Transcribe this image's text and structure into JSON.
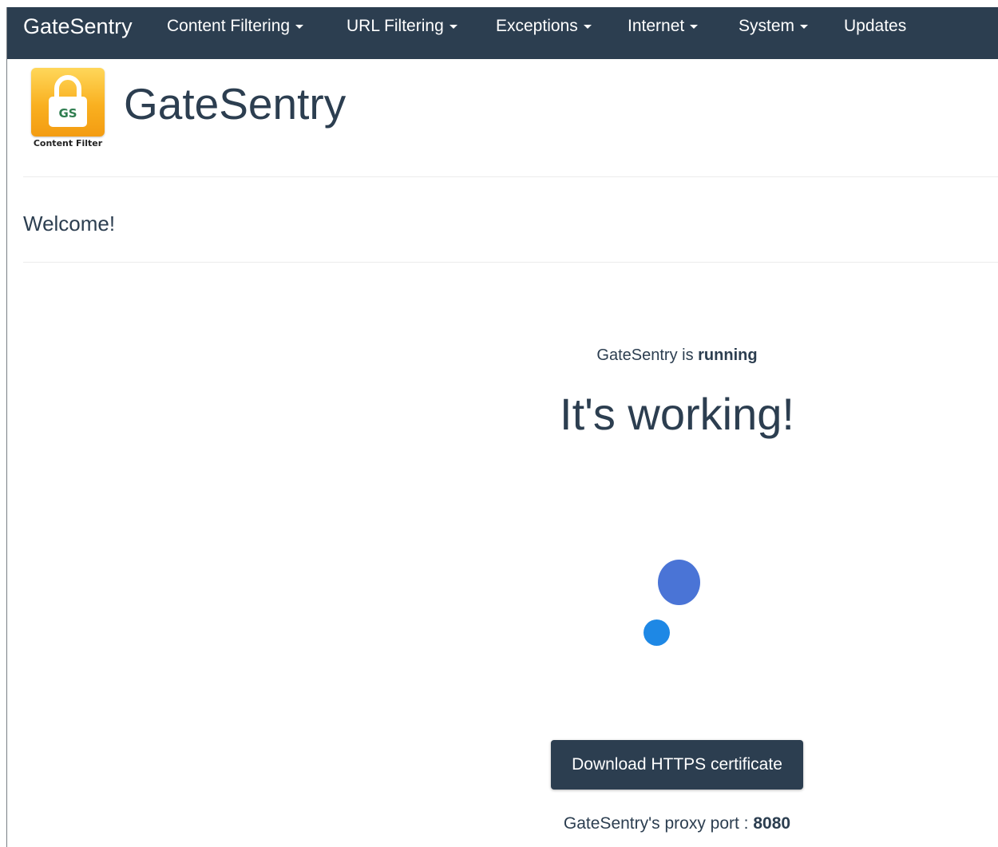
{
  "navbar": {
    "brand": "GateSentry",
    "items": [
      {
        "label": "Content Filtering",
        "dropdown": true
      },
      {
        "label": "URL Filtering",
        "dropdown": true
      },
      {
        "label": "Exceptions",
        "dropdown": true
      },
      {
        "label": "Internet",
        "dropdown": true
      },
      {
        "label": "System",
        "dropdown": true
      },
      {
        "label": "Updates",
        "dropdown": false
      }
    ]
  },
  "header": {
    "logo_text": "GS",
    "logo_caption": "Content Filter",
    "title": "GateSentry"
  },
  "welcome": "Welcome!",
  "status": {
    "prefix": "GateSentry is ",
    "state": "running",
    "message": "It's working!"
  },
  "spinner": {
    "dot_colors": [
      "#4a74d6",
      "#1e88e5"
    ]
  },
  "actions": {
    "download_cert_label": "Download HTTPS certificate"
  },
  "proxy": {
    "label": "GateSentry's proxy port : ",
    "port": "8080"
  },
  "colors": {
    "navbar_bg": "#2c3e50",
    "text_primary": "#2c3e50",
    "logo_gradient_top": "#ffd75a",
    "logo_gradient_bottom": "#f39c12",
    "logo_text": "#2e7d4f"
  }
}
